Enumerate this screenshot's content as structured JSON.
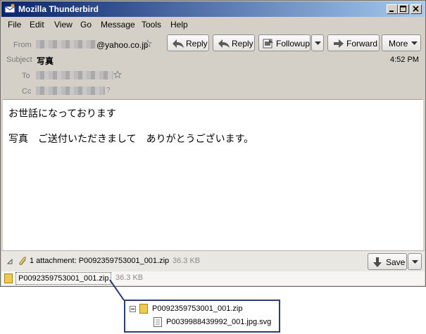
{
  "window": {
    "title": "Mozilla Thunderbird"
  },
  "menu": [
    "File",
    "Edit",
    "View",
    "Go",
    "Message",
    "Tools",
    "Help"
  ],
  "header": {
    "from_label": "From",
    "from_value": "@yahoo.co.jp",
    "subject_label": "Subject",
    "subject_value": "写真",
    "to_label": "To",
    "cc_label": "Cc",
    "time": "4:52 PM"
  },
  "toolbar": {
    "reply": "Reply",
    "reply_all": "Reply",
    "followup": "Followup",
    "forward": "Forward",
    "more": "More"
  },
  "message": {
    "lines": [
      "お世話になっております",
      "写真　ご送付いただきまして　ありがとうございます。"
    ]
  },
  "attachments": {
    "summary": "1 attachment: P0092359753001_001.zip",
    "summary_size": "36.3 KB",
    "save_label": "Save",
    "file_name": "P0092359753001_001.zip",
    "file_size": "36.3 KB"
  },
  "popup": {
    "zip_name": "P0092359753001_001.zip",
    "child_name": "P0039988439992_001.jpg.svg"
  },
  "icons": [
    "thunderbird-app-icon",
    "minimize-icon",
    "maximize-icon",
    "close-icon",
    "star-icon",
    "reply-icon",
    "reply-all-icon",
    "followup-icon",
    "dropdown-arrow-icon",
    "forward-icon",
    "paperclip-icon",
    "collapse-triangle-icon",
    "save-arrow-icon",
    "zip-file-icon",
    "tree-minus-icon",
    "document-icon"
  ],
  "colors": {
    "titlebar_start": "#0a246a",
    "titlebar_end": "#a6caf0",
    "popup_border": "#2c3e73"
  }
}
